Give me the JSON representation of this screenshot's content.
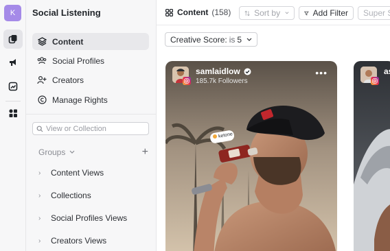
{
  "workspace": {
    "avatar_letter": "K"
  },
  "sidebar": {
    "title": "Social Listening",
    "nav": [
      {
        "label": "Content",
        "icon": "layers-icon",
        "active": true
      },
      {
        "label": "Social Profiles",
        "icon": "users-group-icon",
        "active": false
      },
      {
        "label": "Creators",
        "icon": "user-plus-icon",
        "active": false
      },
      {
        "label": "Manage Rights",
        "icon": "copyright-icon",
        "active": false
      }
    ],
    "search_placeholder": "View or Collection",
    "groups_label": "Groups",
    "tree": [
      {
        "label": "Content Views"
      },
      {
        "label": "Collections"
      },
      {
        "label": "Social Profiles Views"
      },
      {
        "label": "Creators Views"
      }
    ]
  },
  "topbar": {
    "title": "Content",
    "count": "(158)",
    "sort_label": "Sort by",
    "filter_label": "Add Filter",
    "super_label": "Super S"
  },
  "filter_chip": {
    "field": "Creative Score:",
    "op": "is",
    "value": "5"
  },
  "cards": [
    {
      "username": "samlaidlow",
      "followers": "185.7k Followers",
      "verified": true,
      "platform": "instagram-icon",
      "sticker_text": "ketone"
    },
    {
      "username": "as",
      "platform": "instagram-icon"
    }
  ],
  "colors": {
    "accent": "#a58ae8",
    "instagram": "#e6294a"
  }
}
